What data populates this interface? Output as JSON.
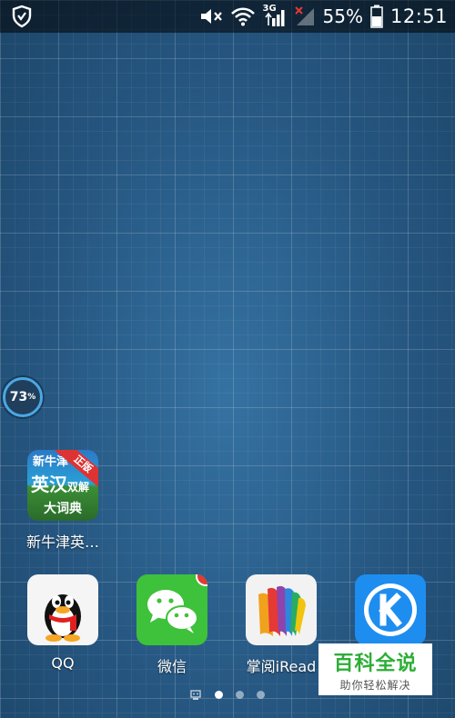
{
  "status_bar": {
    "network_type": "3G",
    "battery_percent": "55%",
    "time": "12:51",
    "icons": [
      "shield-icon",
      "mute-icon",
      "wifi-icon",
      "signal-icon",
      "signal-no-sim-icon",
      "battery-icon"
    ]
  },
  "booster": {
    "value": "73",
    "unit": "%"
  },
  "dict_app": {
    "label": "新牛津英…",
    "icon_text_top": "新牛津",
    "icon_text_main": "英汉",
    "icon_text_side": "双解",
    "icon_text_bottom": "大词典",
    "ribbon": "正版"
  },
  "dock": [
    {
      "label": "QQ"
    },
    {
      "label": "微信",
      "badge": "···"
    },
    {
      "label": "掌阅iRead"
    },
    {
      "label": ""
    }
  ],
  "pages": {
    "count": 3,
    "current": 1
  },
  "watermark": {
    "title": "百科全说",
    "subtitle": "助你轻松解决"
  },
  "colors": {
    "wechat_green": "#3ec13b",
    "kugou_blue": "#1e8df0",
    "badge_red": "#e53935"
  }
}
